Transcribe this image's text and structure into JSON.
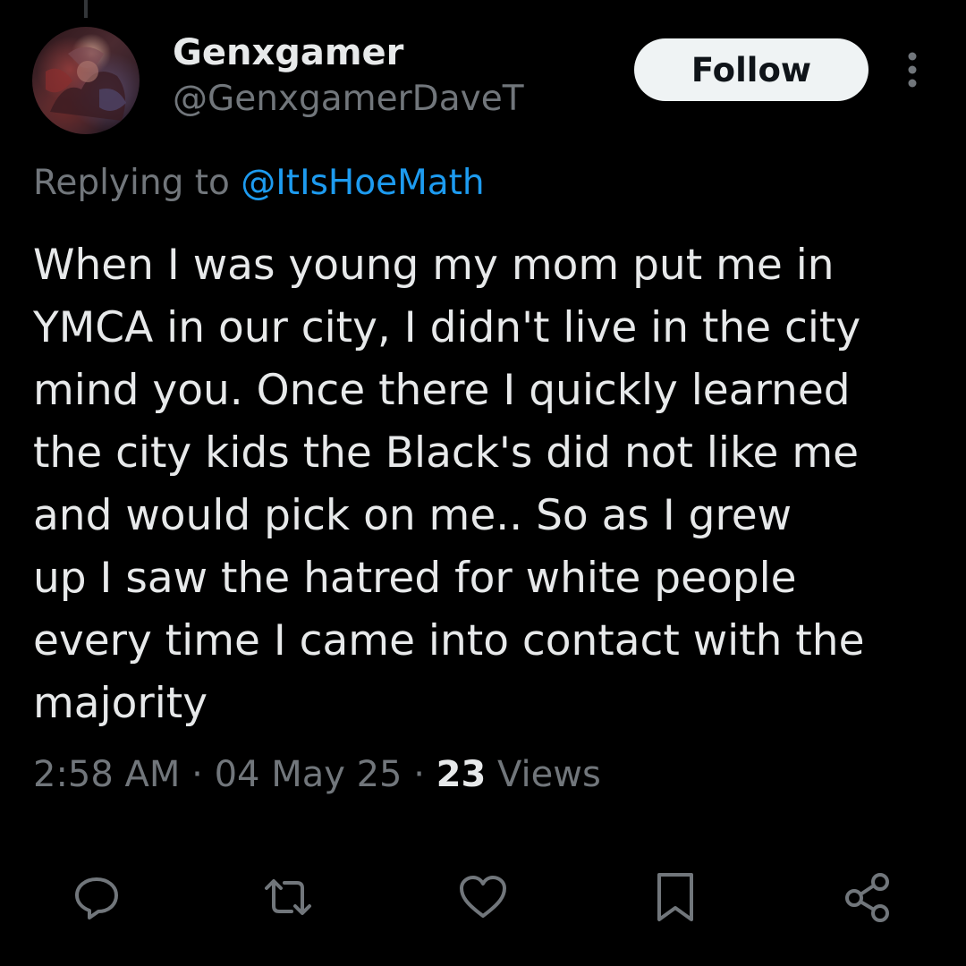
{
  "tweet": {
    "author": {
      "display_name": "Genxgamer",
      "handle": "@GenxgamerDaveT"
    },
    "follow_label": "Follow",
    "replying_to": {
      "prefix": "Replying to",
      "handle": "@ItIsHoeMath"
    },
    "text_lines": [
      "When I was young my mom put me in",
      "YMCA in our city, I didn't live in the city",
      "mind you. Once there I quickly learned",
      "the city kids the Black's did not like me",
      "and would pick on me.. So as I grew",
      "up I saw the hatred for white people",
      "every time I came into contact with the",
      "majority"
    ],
    "meta": {
      "time": "2:58 AM",
      "separator": "·",
      "date": "04 May 25",
      "views_count": "23",
      "views_label": "Views"
    },
    "actions": [
      {
        "icon": "reply-icon"
      },
      {
        "icon": "retweet-icon"
      },
      {
        "icon": "like-icon"
      },
      {
        "icon": "bookmark-icon"
      },
      {
        "icon": "share-icon"
      }
    ]
  },
  "colors": {
    "background": "#000000",
    "text_primary": "#e7e9ea",
    "text_secondary": "#71767b",
    "accent": "#1d9bf0",
    "follow_button_bg": "#eff3f4"
  }
}
